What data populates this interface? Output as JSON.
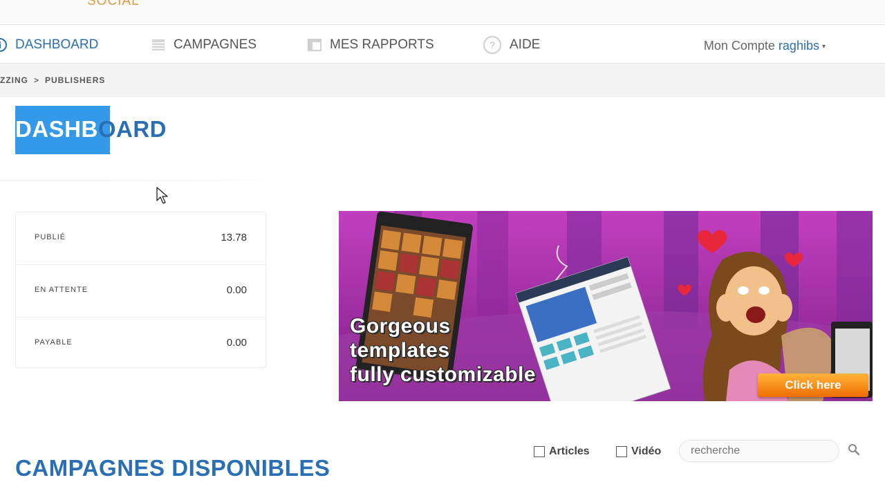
{
  "logo": {
    "text": "SOCIAL"
  },
  "nav": {
    "items": [
      {
        "label": "DASHBOARD",
        "icon": "info-icon",
        "active": true
      },
      {
        "label": "CAMPAGNES",
        "icon": "list-icon",
        "active": false
      },
      {
        "label": "MES RAPPORTS",
        "icon": "report-icon",
        "active": false
      },
      {
        "label": "AIDE",
        "icon": "help-icon",
        "active": false
      }
    ],
    "account_prefix": "Mon Compte",
    "account_user": "raghibs",
    "account_caret": "▾"
  },
  "breadcrumb": {
    "first": "ZZING",
    "separator": ">",
    "current": "PUBLISHERS"
  },
  "page": {
    "title_selected": "DASHB",
    "title_rest": "OARD"
  },
  "stats": [
    {
      "label": "PUBLIÉ",
      "value": "13.78"
    },
    {
      "label": "EN ATTENTE",
      "value": "0.00"
    },
    {
      "label": "PAYABLE",
      "value": "0.00"
    }
  ],
  "banner": {
    "lines": [
      "Gorgeous",
      "templates",
      "fully customizable"
    ],
    "cta": "Click here"
  },
  "campaigns": {
    "title": "CAMPAGNES DISPONIBLES",
    "filters": [
      "Articles",
      "Vidéo"
    ],
    "search_placeholder": "recherche"
  },
  "colors": {
    "accent": "#2a6fb3",
    "selection": "#3399e8",
    "logo": "#e09a45",
    "banner_bg": "#b23dbb",
    "cta": "#f58a12"
  }
}
